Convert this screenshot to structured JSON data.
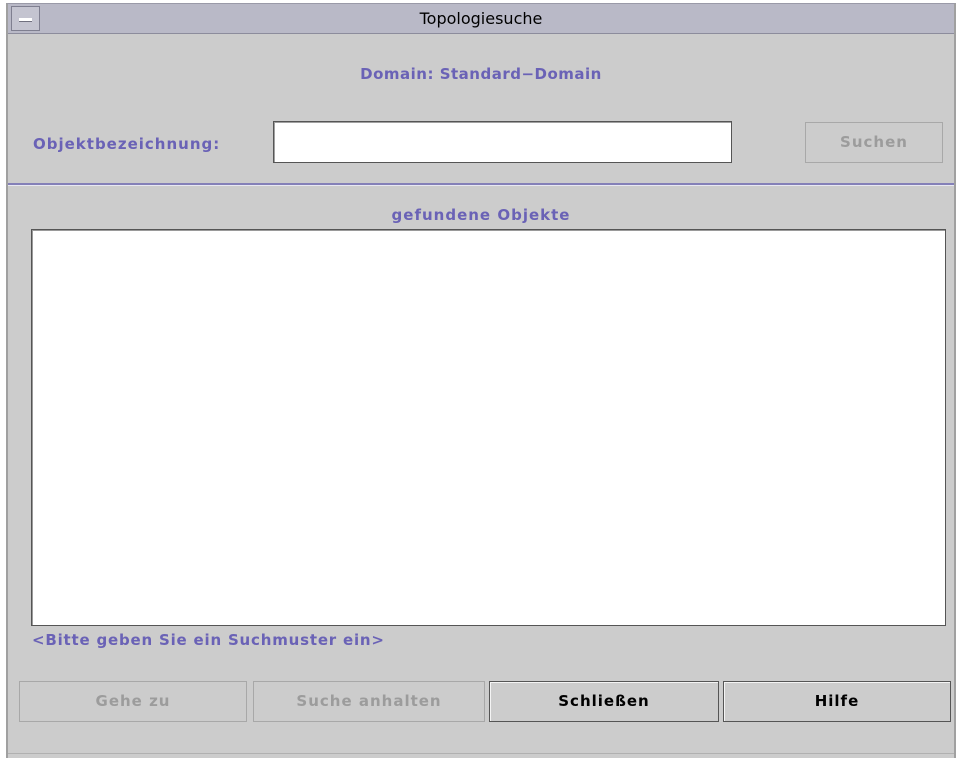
{
  "window": {
    "title": "Topologiesuche",
    "system_menu_icon": "window-menu-icon"
  },
  "domain": {
    "label": "Domain: Standard−Domain"
  },
  "search": {
    "field_label": "Objektbezeichnung:",
    "value": "",
    "placeholder": "",
    "button_label": "Suchen",
    "button_enabled": false
  },
  "results": {
    "heading": "gefundene Objekte",
    "items": []
  },
  "status": {
    "text": "<Bitte geben Sie ein Suchmuster ein>"
  },
  "buttons": {
    "goto": {
      "label": "Gehe zu",
      "enabled": false
    },
    "stop_search": {
      "label": "Suche anhalten",
      "enabled": false
    },
    "close": {
      "label": "Schließen",
      "enabled": true
    },
    "help": {
      "label": "Hilfe",
      "enabled": true
    }
  },
  "colors": {
    "label_text": "#6a62b6",
    "window_bg": "#cccccc",
    "titlebar_bg": "#b9b9c7",
    "disabled_text": "#9c9c9c"
  }
}
